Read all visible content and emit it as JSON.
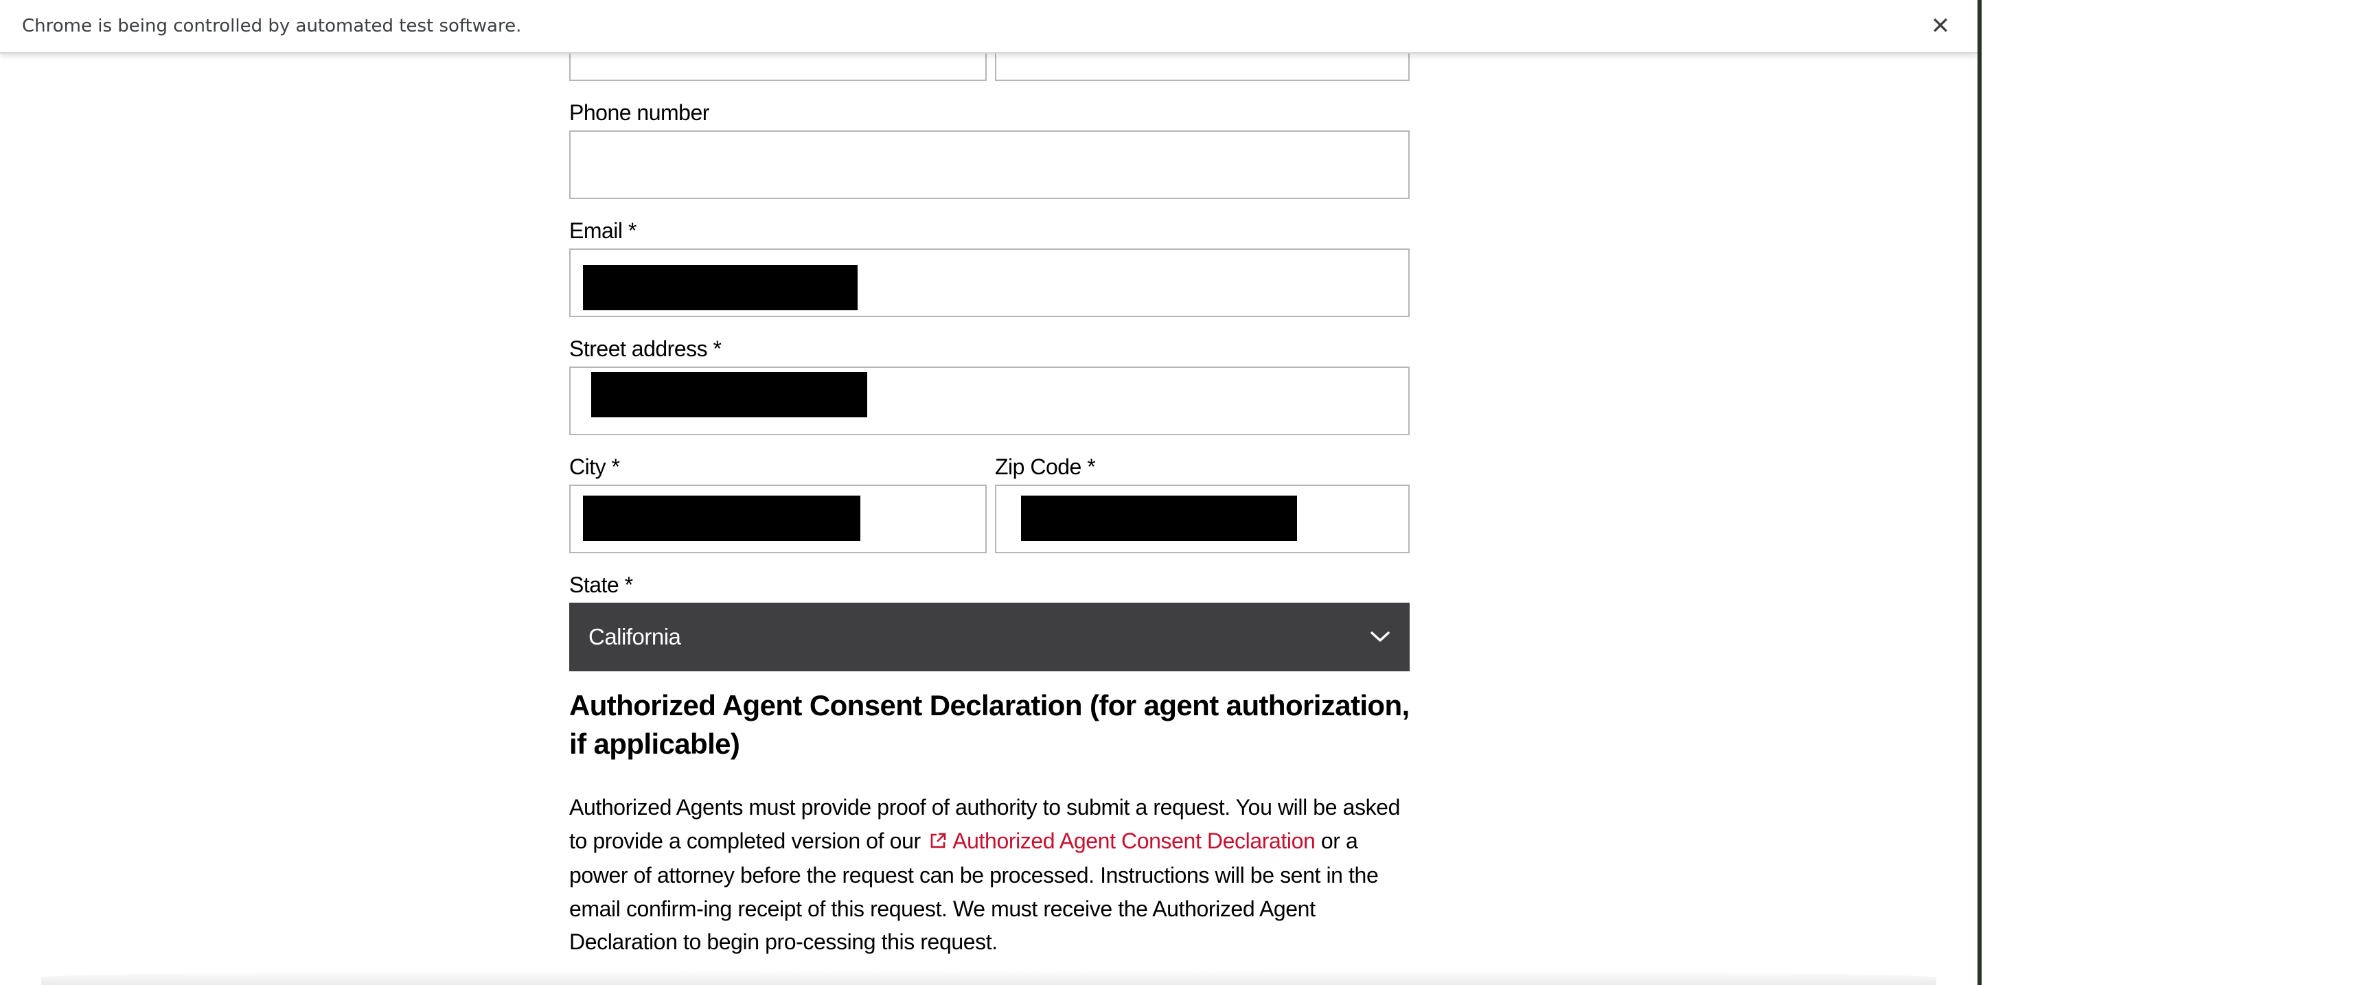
{
  "browser": {
    "infobar_text": "Chrome is being controlled by automated test software.",
    "close_glyph": "✕"
  },
  "form": {
    "phone": {
      "label": "Phone number",
      "value": ""
    },
    "email": {
      "label": "Email *",
      "value": "[redacted]"
    },
    "street": {
      "label": "Street address *",
      "value": "[redacted]"
    },
    "city": {
      "label": "City *",
      "value": "[redacted]"
    },
    "zip": {
      "label": "Zip Code *",
      "value": "[redacted]"
    },
    "state": {
      "label": "State *",
      "selected": "California"
    }
  },
  "consent": {
    "heading": "Authorized Agent Consent Declaration (for agent authorization, if applicable)",
    "para_before": "Authorized Agents must provide proof of authority to submit a request. You will be asked to provide a completed version of our ",
    "link_text": "Authorized Agent Consent Declaration",
    "para_after": " or a power of attorney before the request can be processed. Instructions will be sent in the email confirm-ing receipt of this request. We must receive the Authorized Agent Declaration to begin pro-cessing this request."
  },
  "colors": {
    "link": "#c8102e",
    "select_bg": "#3f3f42",
    "input_border": "#b6b6b8"
  },
  "icons": {
    "close": "close-icon",
    "chevron": "chevron-down-icon",
    "external": "external-link-icon"
  }
}
